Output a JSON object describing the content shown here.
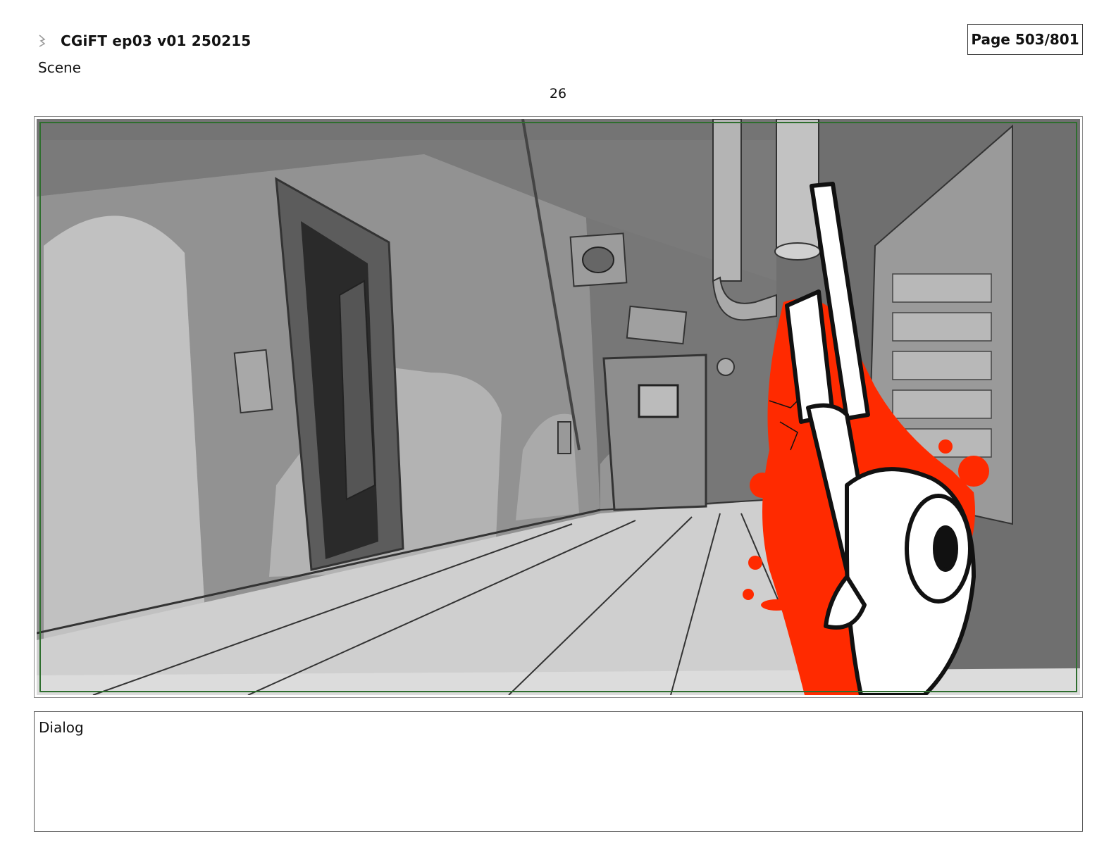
{
  "header": {
    "logo_icon": "storyboard-logo-icon",
    "title": "CGiFT ep03 v01 250215",
    "page": "Page 503/801"
  },
  "scene": {
    "label": "Scene",
    "panel_number": "26"
  },
  "panel": {
    "image_description": "storyboard-drawing-hallway",
    "colors": {
      "frame_border": "#2e6e2e",
      "splatter": "#ff2a00",
      "background_gray": "#8a8a8a"
    }
  },
  "dialog": {
    "label": "Dialog",
    "text": ""
  }
}
